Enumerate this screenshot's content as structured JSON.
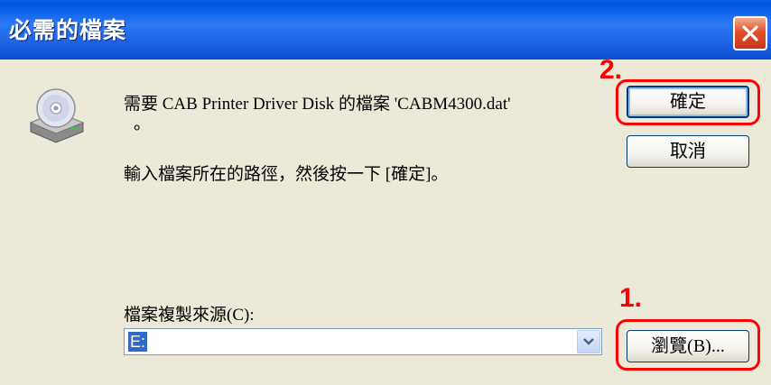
{
  "dialog": {
    "title": "必需的檔案",
    "message_line1": "需要 CAB Printer Driver Disk 的檔案 'CABM4300.dat'",
    "message_line1_cont": "。",
    "message_line2": "輸入檔案所在的路徑，然後按一下 [確定]。",
    "source_label": "檔案複製來源(C):",
    "source_value": "E:",
    "ok_label": "確定",
    "cancel_label": "取消",
    "browse_label": "瀏覽(B)..."
  },
  "annotations": {
    "step1": "1.",
    "step2": "2."
  },
  "icons": {
    "close": "close-icon",
    "disk": "cd-drive-icon",
    "dropdown": "chevron-down-icon"
  },
  "colors": {
    "titlebar": "#0058e6",
    "body": "#ece9d8",
    "close": "#e0502a",
    "annotation": "#ff0000",
    "selection": "#316ac5"
  }
}
